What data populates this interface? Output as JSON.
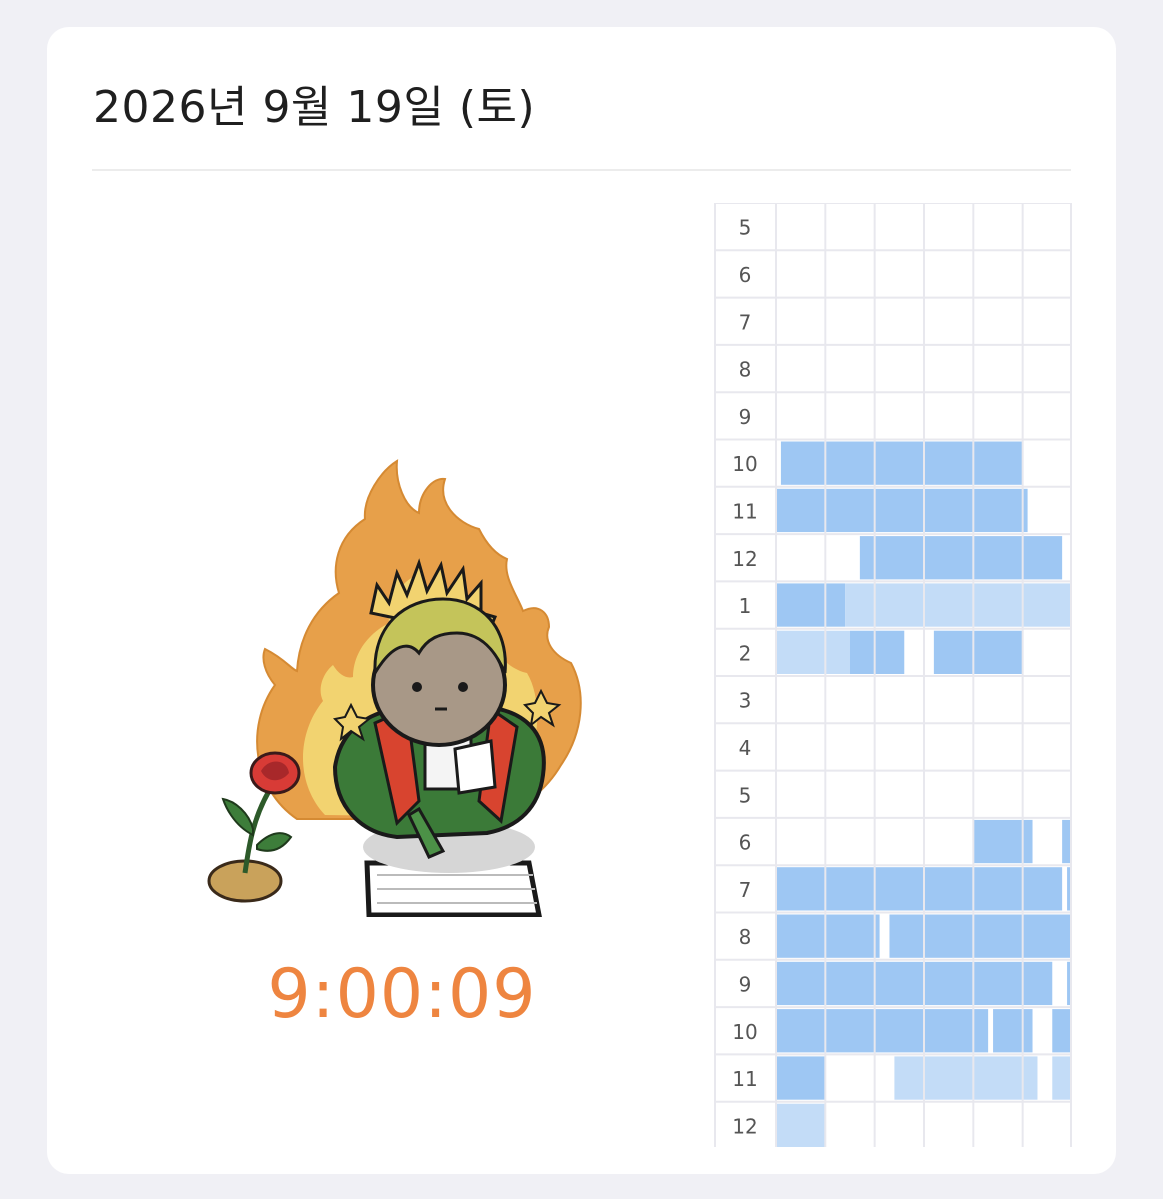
{
  "header": {
    "date": "2026년 9월 19일 (토)"
  },
  "timer": {
    "value": "9:00:09"
  },
  "illustration": {
    "subject": "child-writing-in-flames-with-rose"
  },
  "colors": {
    "background": "#f0f0f5",
    "card": "#ffffff",
    "timer": "#ee8540",
    "study_strong": "#9ec7f3",
    "study_light": "#c3dcf7",
    "grid_line": "#e8e8ee"
  },
  "timetable": {
    "hours": [
      "5",
      "6",
      "7",
      "8",
      "9",
      "10",
      "11",
      "12",
      "1",
      "2",
      "3",
      "4",
      "5",
      "6",
      "7",
      "8",
      "9",
      "10",
      "11",
      "12"
    ],
    "minutes_per_cell": 10,
    "cells_per_hour": 6,
    "sessions": [
      {
        "hour_index": 5,
        "start_min": 1,
        "end_min": 50,
        "shade": "strong"
      },
      {
        "hour_index": 6,
        "start_min": 0,
        "end_min": 51,
        "shade": "strong"
      },
      {
        "hour_index": 7,
        "start_min": 17,
        "end_min": 58,
        "shade": "strong"
      },
      {
        "hour_index": 8,
        "start_min": 0,
        "end_min": 14,
        "shade": "strong"
      },
      {
        "hour_index": 8,
        "start_min": 14,
        "end_min": 60,
        "shade": "light"
      },
      {
        "hour_index": 9,
        "start_min": 0,
        "end_min": 15,
        "shade": "light"
      },
      {
        "hour_index": 9,
        "start_min": 15,
        "end_min": 26,
        "shade": "strong"
      },
      {
        "hour_index": 9,
        "start_min": 32,
        "end_min": 50,
        "shade": "strong"
      },
      {
        "hour_index": 13,
        "start_min": 40,
        "end_min": 52,
        "shade": "strong"
      },
      {
        "hour_index": 13,
        "start_min": 58,
        "end_min": 60,
        "shade": "strong"
      },
      {
        "hour_index": 14,
        "start_min": 0,
        "end_min": 58,
        "shade": "strong"
      },
      {
        "hour_index": 14,
        "start_min": 59,
        "end_min": 60,
        "shade": "strong"
      },
      {
        "hour_index": 15,
        "start_min": 0,
        "end_min": 21,
        "shade": "strong"
      },
      {
        "hour_index": 15,
        "start_min": 23,
        "end_min": 60,
        "shade": "strong"
      },
      {
        "hour_index": 16,
        "start_min": 0,
        "end_min": 56,
        "shade": "strong"
      },
      {
        "hour_index": 16,
        "start_min": 59,
        "end_min": 60,
        "shade": "strong"
      },
      {
        "hour_index": 17,
        "start_min": 0,
        "end_min": 43,
        "shade": "strong"
      },
      {
        "hour_index": 17,
        "start_min": 44,
        "end_min": 52,
        "shade": "strong"
      },
      {
        "hour_index": 17,
        "start_min": 56,
        "end_min": 60,
        "shade": "strong"
      },
      {
        "hour_index": 18,
        "start_min": 0,
        "end_min": 10,
        "shade": "strong"
      },
      {
        "hour_index": 18,
        "start_min": 24,
        "end_min": 53,
        "shade": "light"
      },
      {
        "hour_index": 18,
        "start_min": 56,
        "end_min": 60,
        "shade": "light"
      },
      {
        "hour_index": 19,
        "start_min": 0,
        "end_min": 10,
        "shade": "light"
      }
    ]
  }
}
